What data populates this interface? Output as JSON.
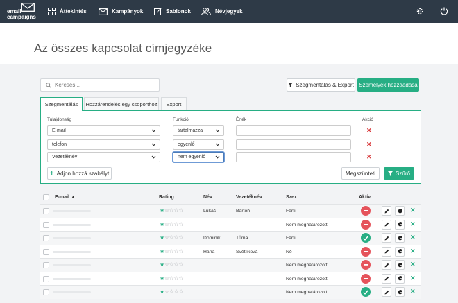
{
  "nav": {
    "logo_line1": "email",
    "logo_line2": "campaigns",
    "items": [
      {
        "label": "Áttekintés",
        "icon": "grid-icon"
      },
      {
        "label": "Kampányok",
        "icon": "envelope-icon"
      },
      {
        "label": "Sablonok",
        "icon": "edit-icon"
      },
      {
        "label": "Névjegyek",
        "icon": "users-icon"
      }
    ],
    "right_icons": [
      "gear-icon",
      "power-icon"
    ]
  },
  "page": {
    "title": "Az összes kapcsolat címjegyzéke"
  },
  "search": {
    "placeholder": "Keresés..."
  },
  "buttons": {
    "segment_export": "Szegmentálás & Export",
    "add_persons": "Személyek hozzáadása",
    "add_rule": "Adjon hozzá szabályt",
    "cancel": "Megszünteti",
    "filter": "Szűrő"
  },
  "tabs": [
    {
      "label": "Szegmentálás",
      "active": true
    },
    {
      "label": "Hozzárendelés egy csoporthoz",
      "active": false
    },
    {
      "label": "Export",
      "active": false
    }
  ],
  "filter": {
    "headers": {
      "property": "Tulajdonság",
      "function": "Funkció",
      "value": "Érték",
      "action": "Akció"
    },
    "rules": [
      {
        "property": "E-mail",
        "function": "tartalmazza",
        "value": ""
      },
      {
        "property": "telefon",
        "function": "egyenlő",
        "value": ""
      },
      {
        "property": "Vezetéknév",
        "function": "nem egyenlő",
        "value": ""
      }
    ]
  },
  "table": {
    "headers": {
      "email": "E-mail",
      "rating": "Rating",
      "first_name": "Név",
      "last_name": "Vezetéknév",
      "gender": "Szex",
      "active": "Aktív"
    },
    "rows": [
      {
        "first_name": "Lukáš",
        "last_name": "Bartoň",
        "gender": "Férfi",
        "active": false,
        "rating": 1
      },
      {
        "first_name": "",
        "last_name": "",
        "gender": "Nem meghatározott",
        "active": false,
        "rating": 1
      },
      {
        "first_name": "Dominik",
        "last_name": "Tůma",
        "gender": "Férfi",
        "active": true,
        "rating": 1
      },
      {
        "first_name": "Hana",
        "last_name": "Světlíková",
        "gender": "Nő",
        "active": false,
        "rating": 1
      },
      {
        "first_name": "",
        "last_name": "",
        "gender": "Nem meghatározott",
        "active": false,
        "rating": 1
      },
      {
        "first_name": "",
        "last_name": "",
        "gender": "Nem meghatározott",
        "active": false,
        "rating": 1
      },
      {
        "first_name": "",
        "last_name": "",
        "gender": "Nem meghatározott",
        "active": true,
        "rating": 1
      }
    ]
  },
  "colors": {
    "nav_bg": "#2e3a47",
    "accent_green": "#27ae84",
    "inactive_red": "#e5535b"
  }
}
